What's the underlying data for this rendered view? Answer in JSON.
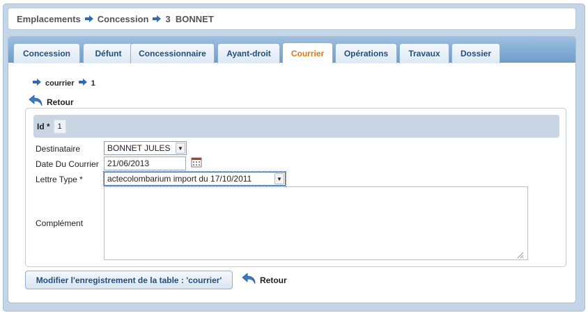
{
  "breadcrumb": {
    "items": [
      "Emplacements",
      "Concession",
      "3  BONNET"
    ]
  },
  "tabs": [
    "Concession",
    "Défunt",
    "Concessionnaire",
    "Ayant-droit",
    "Courrier",
    "Opérations",
    "Travaux",
    "Dossier"
  ],
  "active_tab": "Courrier",
  "sub_breadcrumb": {
    "table": "courrier",
    "id": "1"
  },
  "retour_label": "Retour",
  "form": {
    "id_label": "Id *",
    "id_value": "1",
    "destinataire_label": "Destinataire",
    "destinataire_value": "BONNET JULES",
    "date_label": "Date Du Courrier",
    "date_value": "21/06/2013",
    "lettre_label": "Lettre Type *",
    "lettre_value": "actecolombarium import du 17/10/2011",
    "complement_label": "Complément",
    "complement_value": ""
  },
  "submit_label": "Modifier l'enregistrement de la table : 'courrier'",
  "colors": {
    "accent": "#e07712",
    "tab_text": "#1f4e82",
    "frame": "#c3d5e6"
  }
}
